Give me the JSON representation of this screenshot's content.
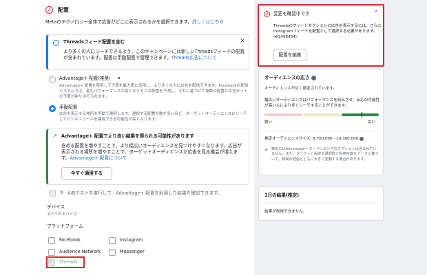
{
  "placement": {
    "title": "配置",
    "desc_prefix": "Metaのテクノロジー全体で広告がどこに表示されるかを選択できます。",
    "desc_link": "詳しくはこちら"
  },
  "threads_notice": {
    "title": "Threadsフィード配置を含む",
    "body_1": "より多くの人にリーチできるよう、このキャンペーンには新しいThreadsフィードの配置が含まれています。配置は手動配置で管理できます。",
    "link": "Threads広告について",
    "close": "×"
  },
  "options": {
    "advantage_label": "Advantage+ 配置(推奨)",
    "advantage_desc": "Advantage+ 配置を使用して予算を最大限に活用し、より多くの人に広告を配信できます。Facebookの配信システムでは、最もパフォーマンスが高くなりそうな配置を予測し、それに基づいて複数の配置に広告セットの予算が割り当てられます。",
    "manual_label": "手動配置",
    "manual_desc": "広告を表示する場所を手動で選択します。選択する配置の数が多いほど、ターゲットオーディエンスにリーチしてビジネスゴールを達成できる可能性が高くなります。"
  },
  "advantage_box": {
    "title": "Advantage+ 配置でより良い結果を得られる可能性があります",
    "body": "含める配置を増やすことで、より幅広いオーディエンスを見つけやすくなります。広告が表示される場所を増やすことで、ターゲットオーディエンスが広告を見る機会が増えます。",
    "link": "Advantage+ 配置について",
    "apply_button": "今すぐ適用する"
  },
  "ab_test": "A/Bテストを実行して、Advantage+ 配置を利用した結果を確認できます。",
  "devices": {
    "title": "デバイス",
    "value": "すべてのデバイス"
  },
  "platforms": {
    "title": "プラットフォーム",
    "items": [
      "Facebook",
      "Instagram",
      "Audience Network",
      "Messenger",
      "Threads"
    ]
  },
  "review_card": {
    "title": "変更を確認中です",
    "body": "Threadsのフィードセクションに広告を表示するには、さらにInstagramフィードを配置として選択する必要があります。(#2490494)",
    "button": "配置を編集"
  },
  "audience_card": {
    "title": "オーディエンスの広さ",
    "status": "オーディエンスが広く設定されています。",
    "advice": "幅広いオーディエンスはパフォーマンスを向上させ、反応の可能性が高い人により多くリーチすることができます。",
    "narrow": "狭い",
    "wide": "広い",
    "estimate_label": "推定オーディエンスサイズ: ",
    "estimate_value": "8,700,000 - 10,300,000",
    "note": "推定にはAdvantage+ オーディエンスのオプションは含まれていません。また、ターゲット設定の選択肢と利用可能なデータに基づいて、時間の経過とともに大きく変動する場合があります。",
    "level": 0.85
  },
  "results_card": {
    "title": "1日の結果(推定)",
    "body": "結果が利用できません。"
  },
  "colors": {
    "accent": "#1877f2",
    "alert": "#e0262d",
    "success": "#2a8a46"
  }
}
